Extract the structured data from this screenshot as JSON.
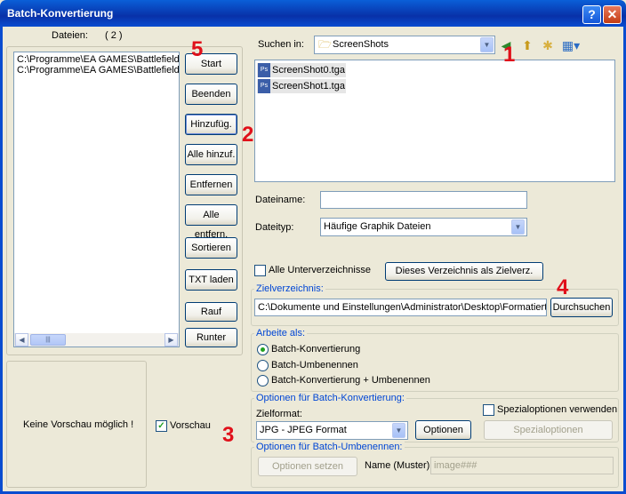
{
  "window": {
    "title": "Batch-Konvertierung",
    "help_label": "?",
    "close_label": "✕"
  },
  "files_panel": {
    "label": "Dateien:",
    "count": "( 2 )",
    "items": [
      "C:\\Programme\\EA GAMES\\Battlefield",
      "C:\\Programme\\EA GAMES\\Battlefield"
    ]
  },
  "buttons": {
    "start": "Start",
    "beenden": "Beenden",
    "hinzufuegen": "Hinzufüg.",
    "alle_hinzu": "Alle hinzuf.",
    "entfernen": "Entfernen",
    "alle_entf": "Alle entfern.",
    "sortieren": "Sortieren",
    "txt_laden": "TXT laden",
    "rauf": "Rauf",
    "runter": "Runter"
  },
  "preview": {
    "text": "Keine Vorschau möglich !",
    "checkbox_label": "Vorschau",
    "checked": true
  },
  "browser": {
    "search_label": "Suchen in:",
    "folder": "ScreenShots",
    "files": [
      "ScreenShot0.tga",
      "ScreenShot1.tga"
    ],
    "file_icon": "Ps",
    "filename_label": "Dateiname:",
    "filename_value": "",
    "filetype_label": "Dateityp:",
    "filetype_value": "Häufige Graphik Dateien",
    "icons": [
      "back-icon",
      "up-folder-icon",
      "new-folder-icon",
      "view-menu-icon"
    ]
  },
  "subdirs": {
    "label": "Alle Unterverzeichnisse",
    "checked": false,
    "button": "Dieses Verzeichnis als Zielverz."
  },
  "target": {
    "title": "Zielverzeichnis:",
    "path": "C:\\Dokumente und Einstellungen\\Administrator\\Desktop\\Formatiert",
    "browse": "Durchsuchen"
  },
  "mode": {
    "title": "Arbeite als:",
    "options": [
      "Batch-Konvertierung",
      "Batch-Umbenennen",
      "Batch-Konvertierung + Umbenennen"
    ],
    "selected": 0
  },
  "convert_options": {
    "title": "Optionen für Batch-Konvertierung:",
    "format_label": "Zielformat:",
    "format_value": "JPG - JPEG Format",
    "options_button": "Optionen",
    "special_check": "Spezialoptionen verwenden",
    "special_button": "Spezialoptionen"
  },
  "rename_options": {
    "title": "Optionen für Batch-Umbenennen:",
    "set_button": "Optionen setzen",
    "pattern_label": "Name (Muster):",
    "pattern_value": "image###"
  },
  "annotations": [
    "1",
    "2",
    "3",
    "4",
    "5"
  ],
  "colors": {
    "titlebar": "#0a4cd0",
    "annotation": "#e0101a",
    "group_title": "#0046d5",
    "window_bg": "#ece9d8"
  }
}
